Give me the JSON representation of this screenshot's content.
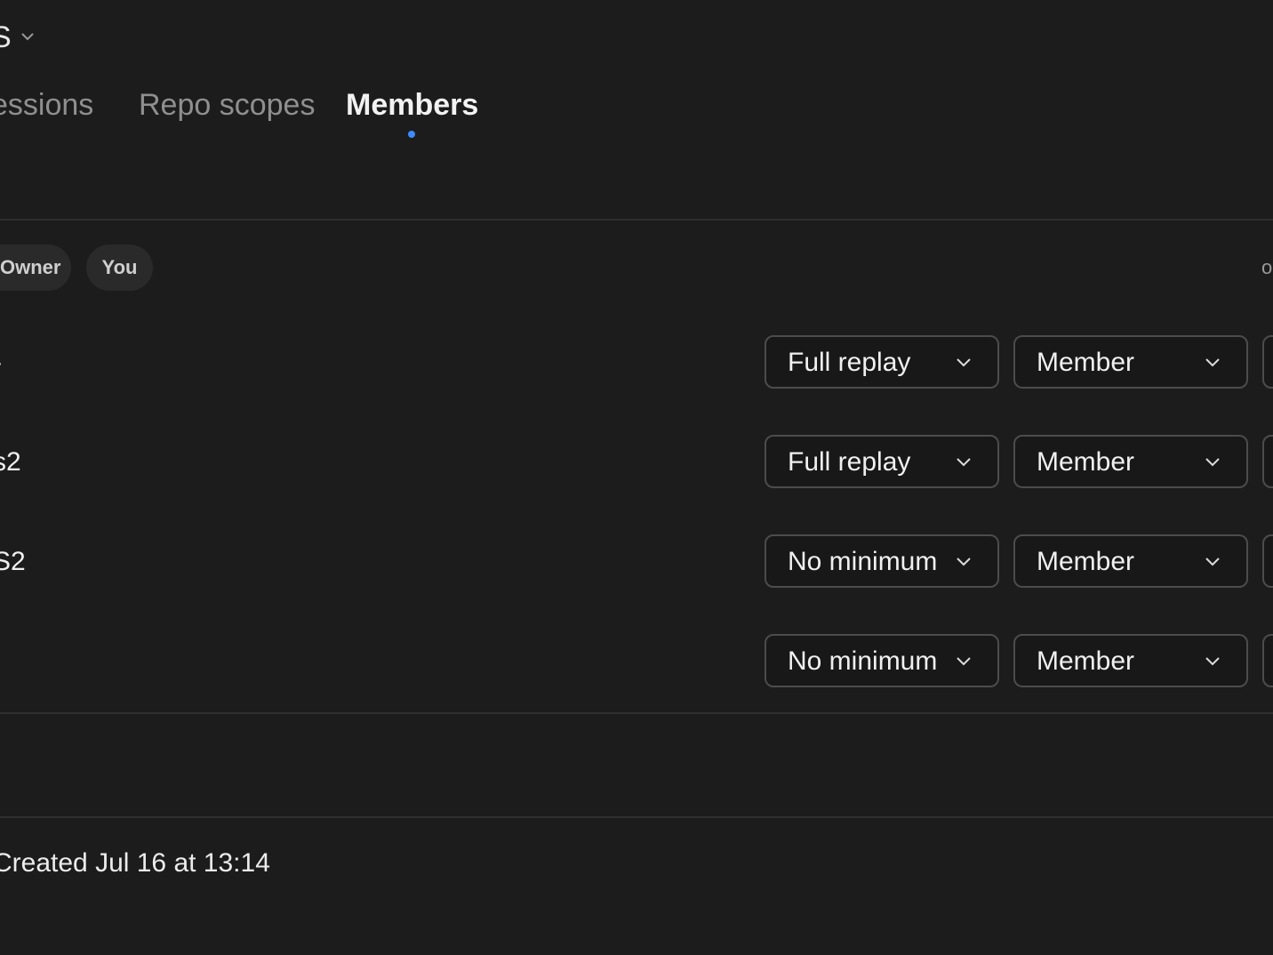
{
  "header": {
    "title": "S",
    "chevron_icon": "chevron-down-icon"
  },
  "tabs": [
    {
      "label": "essions",
      "active": false
    },
    {
      "label": "Repo scopes",
      "active": false
    },
    {
      "label": "Members",
      "active": true
    }
  ],
  "badges": {
    "owner": "Owner",
    "you": "You"
  },
  "right_cut_text": "o",
  "members": [
    {
      "name": "-",
      "replay": "Full replay",
      "role": "Member"
    },
    {
      "name": "s2",
      "replay": "Full replay",
      "role": "Member"
    },
    {
      "name": "S2",
      "replay": "No minimum",
      "role": "Member"
    },
    {
      "name": "",
      "replay": "No minimum",
      "role": "Member"
    }
  ],
  "footer": {
    "created": "Created Jul 16 at 13:14"
  },
  "colors": {
    "background": "#1c1c1c",
    "active_tab_dot": "#3d8bff",
    "border": "#4c4c4c"
  }
}
